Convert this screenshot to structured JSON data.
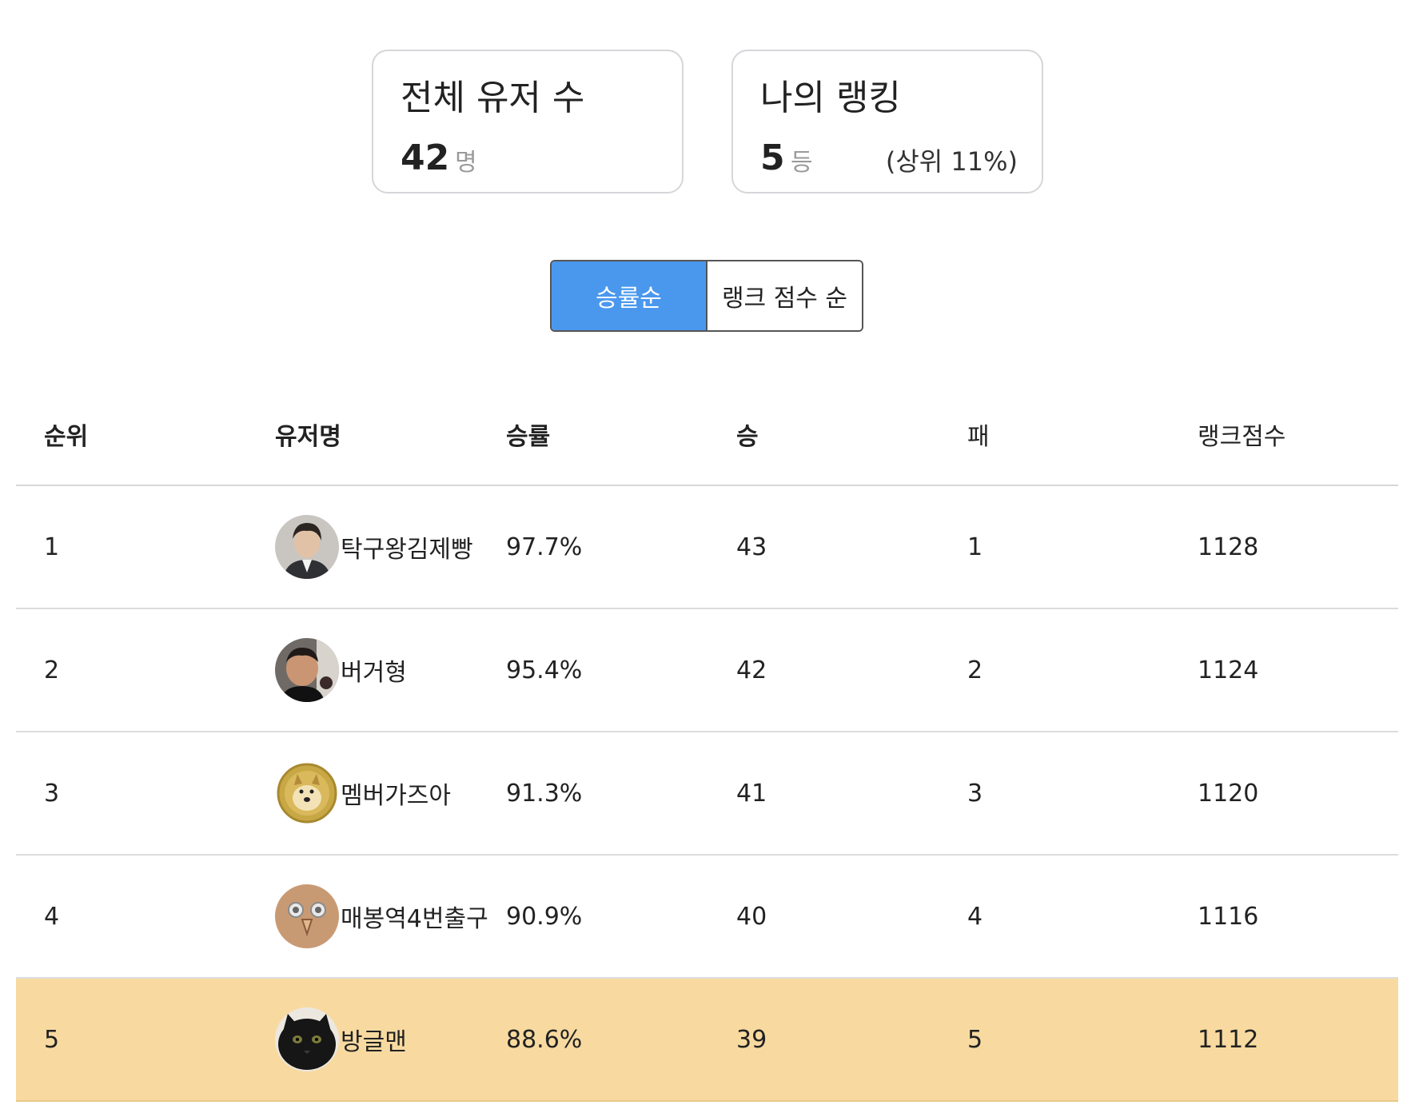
{
  "stats": {
    "total_users": {
      "title": "전체 유저 수",
      "value": "42",
      "unit": "명"
    },
    "my_ranking": {
      "title": "나의 랭킹",
      "value": "5",
      "unit": "등",
      "note": "(상위 11%)"
    }
  },
  "sort_toggle": {
    "options": [
      {
        "label": "승률순",
        "active": true
      },
      {
        "label": "랭크 점수 순",
        "active": false
      }
    ]
  },
  "table": {
    "headers": [
      "순위",
      "유저명",
      "승률",
      "승",
      "패",
      "랭크점수"
    ],
    "rows": [
      {
        "rank": "1",
        "name": "탁구왕김제빵",
        "rate": "97.7%",
        "win": "43",
        "lose": "1",
        "score": "1128",
        "avatar": "person-avatar",
        "highlight": false
      },
      {
        "rank": "2",
        "name": "버거형",
        "rate": "95.4%",
        "win": "42",
        "lose": "2",
        "score": "1124",
        "avatar": "person-avatar",
        "highlight": false
      },
      {
        "rank": "3",
        "name": "멤버가즈아",
        "rate": "91.3%",
        "win": "41",
        "lose": "3",
        "score": "1120",
        "avatar": "doge-coin-avatar",
        "highlight": false
      },
      {
        "rank": "4",
        "name": "매봉역4번출구",
        "rate": "90.9%",
        "win": "40",
        "lose": "4",
        "score": "1116",
        "avatar": "owl-avatar",
        "highlight": false
      },
      {
        "rank": "5",
        "name": "방글맨",
        "rate": "88.6%",
        "win": "39",
        "lose": "5",
        "score": "1112",
        "avatar": "black-cat-avatar",
        "highlight": true
      }
    ],
    "highlight_color": "#f8daa0"
  },
  "colors": {
    "accent": "#4a98ee",
    "border": "#d6d6da"
  }
}
